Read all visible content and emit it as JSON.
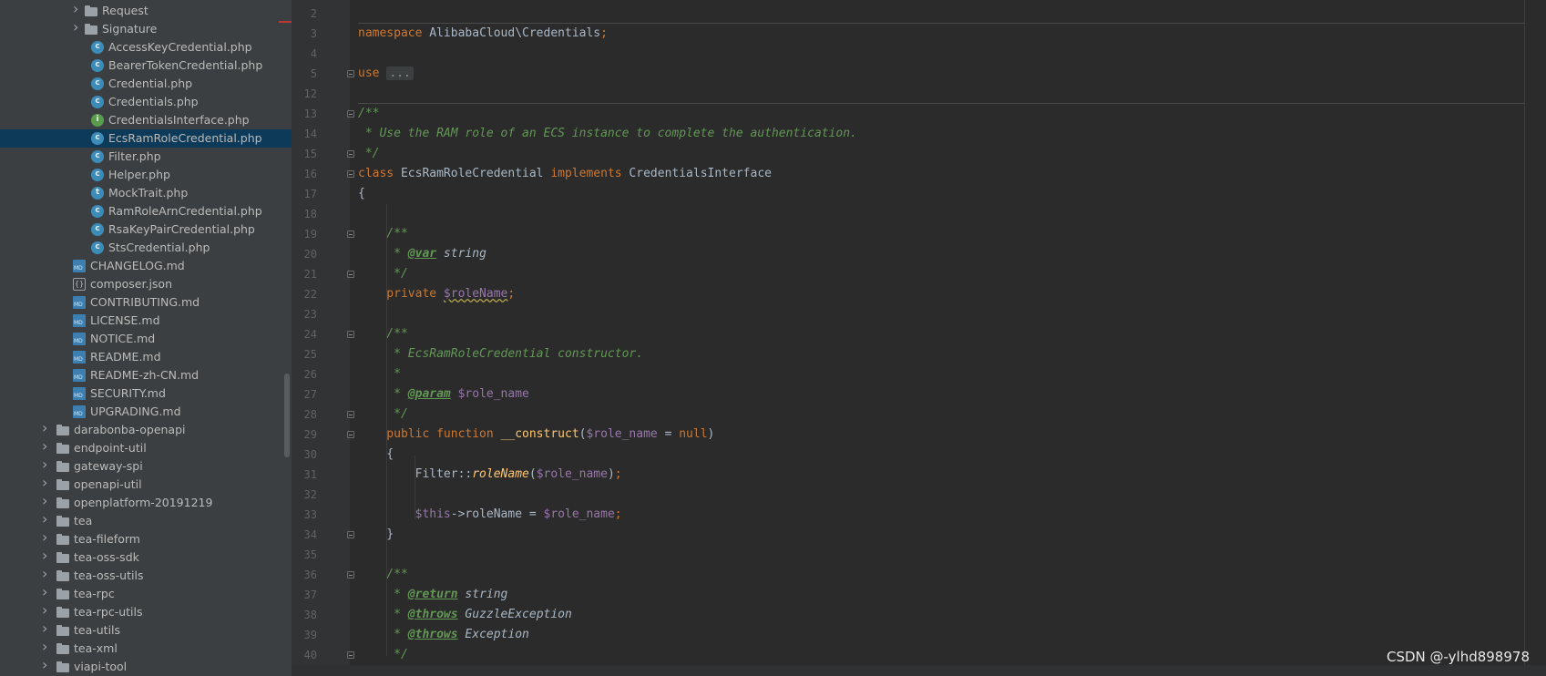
{
  "sidebar": {
    "items": [
      {
        "label": "Request",
        "type": "folder",
        "indent": 1,
        "expandable": true
      },
      {
        "label": "Signature",
        "type": "folder",
        "indent": 1,
        "expandable": true
      },
      {
        "label": "AccessKeyCredential.php",
        "type": "class",
        "indent": 2
      },
      {
        "label": "BearerTokenCredential.php",
        "type": "class",
        "indent": 2
      },
      {
        "label": "Credential.php",
        "type": "class",
        "indent": 2
      },
      {
        "label": "Credentials.php",
        "type": "class",
        "indent": 2
      },
      {
        "label": "CredentialsInterface.php",
        "type": "interface",
        "indent": 2
      },
      {
        "label": "EcsRamRoleCredential.php",
        "type": "class",
        "indent": 2,
        "selected": true
      },
      {
        "label": "Filter.php",
        "type": "class",
        "indent": 2
      },
      {
        "label": "Helper.php",
        "type": "class",
        "indent": 2
      },
      {
        "label": "MockTrait.php",
        "type": "trait",
        "indent": 2
      },
      {
        "label": "RamRoleArnCredential.php",
        "type": "class",
        "indent": 2
      },
      {
        "label": "RsaKeyPairCredential.php",
        "type": "class",
        "indent": 2
      },
      {
        "label": "StsCredential.php",
        "type": "class",
        "indent": 2
      },
      {
        "label": "CHANGELOG.md",
        "type": "md",
        "indent": 1
      },
      {
        "label": "composer.json",
        "type": "json",
        "indent": 1
      },
      {
        "label": "CONTRIBUTING.md",
        "type": "md",
        "indent": 1
      },
      {
        "label": "LICENSE.md",
        "type": "md",
        "indent": 1
      },
      {
        "label": "NOTICE.md",
        "type": "md",
        "indent": 1
      },
      {
        "label": "README.md",
        "type": "md",
        "indent": 1
      },
      {
        "label": "README-zh-CN.md",
        "type": "md",
        "indent": 1
      },
      {
        "label": "SECURITY.md",
        "type": "md",
        "indent": 1
      },
      {
        "label": "UPGRADING.md",
        "type": "md",
        "indent": 1
      },
      {
        "label": "darabonba-openapi",
        "type": "folder",
        "indent": 0,
        "expandable": true
      },
      {
        "label": "endpoint-util",
        "type": "folder",
        "indent": 0,
        "expandable": true
      },
      {
        "label": "gateway-spi",
        "type": "folder",
        "indent": 0,
        "expandable": true
      },
      {
        "label": "openapi-util",
        "type": "folder",
        "indent": 0,
        "expandable": true
      },
      {
        "label": "openplatform-20191219",
        "type": "folder",
        "indent": 0,
        "expandable": true
      },
      {
        "label": "tea",
        "type": "folder",
        "indent": 0,
        "expandable": true
      },
      {
        "label": "tea-fileform",
        "type": "folder",
        "indent": 0,
        "expandable": true
      },
      {
        "label": "tea-oss-sdk",
        "type": "folder",
        "indent": 0,
        "expandable": true
      },
      {
        "label": "tea-oss-utils",
        "type": "folder",
        "indent": 0,
        "expandable": true
      },
      {
        "label": "tea-rpc",
        "type": "folder",
        "indent": 0,
        "expandable": true
      },
      {
        "label": "tea-rpc-utils",
        "type": "folder",
        "indent": 0,
        "expandable": true
      },
      {
        "label": "tea-utils",
        "type": "folder",
        "indent": 0,
        "expandable": true
      },
      {
        "label": "tea-xml",
        "type": "folder",
        "indent": 0,
        "expandable": true
      },
      {
        "label": "viapi-tool",
        "type": "folder",
        "indent": 0,
        "expandable": true
      }
    ]
  },
  "editor": {
    "lines": [
      {
        "n": "2",
        "fold": false,
        "tokens": []
      },
      {
        "n": "3",
        "fold": false,
        "tokens": [
          {
            "t": "namespace",
            "c": "kw"
          },
          {
            "t": " AlibabaCloud\\Credentials"
          },
          {
            "t": ";",
            "c": "kw"
          }
        ]
      },
      {
        "n": "4",
        "fold": false,
        "tokens": []
      },
      {
        "n": "5",
        "fold": true,
        "tokens": [
          {
            "t": "use",
            "c": "kw"
          },
          {
            "t": " "
          },
          {
            "t": "...",
            "c": "ellipsis"
          }
        ]
      },
      {
        "n": "12",
        "fold": false,
        "tokens": []
      },
      {
        "n": "13",
        "fold": true,
        "tokens": [
          {
            "t": "/**",
            "c": "cm"
          }
        ]
      },
      {
        "n": "14",
        "fold": false,
        "tokens": [
          {
            "t": " * Use the RAM role of an ECS instance to complete the authentication.",
            "c": "cm"
          }
        ]
      },
      {
        "n": "15",
        "fold": true,
        "tokens": [
          {
            "t": " */",
            "c": "cm"
          }
        ]
      },
      {
        "n": "16",
        "fold": true,
        "tokens": [
          {
            "t": "class",
            "c": "kw"
          },
          {
            "t": " EcsRamRoleCredential "
          },
          {
            "t": "implements",
            "c": "kw"
          },
          {
            "t": " CredentialsInterface"
          }
        ]
      },
      {
        "n": "17",
        "fold": false,
        "tokens": [
          {
            "t": "{"
          }
        ]
      },
      {
        "n": "18",
        "fold": false,
        "tokens": []
      },
      {
        "n": "19",
        "fold": true,
        "tokens": [
          {
            "t": "    /**",
            "c": "cm"
          }
        ]
      },
      {
        "n": "20",
        "fold": false,
        "tokens": [
          {
            "t": "     * ",
            "c": "cm"
          },
          {
            "t": "@var",
            "c": "tag"
          },
          {
            "t": " string",
            "c": "typ"
          }
        ]
      },
      {
        "n": "21",
        "fold": true,
        "tokens": [
          {
            "t": "     */",
            "c": "cm"
          }
        ]
      },
      {
        "n": "22",
        "fold": false,
        "tokens": [
          {
            "t": "    private ",
            "c": "kw"
          },
          {
            "t": "$roleName",
            "c": "varw"
          },
          {
            "t": ";",
            "c": "kw"
          }
        ]
      },
      {
        "n": "23",
        "fold": false,
        "tokens": []
      },
      {
        "n": "24",
        "fold": true,
        "tokens": [
          {
            "t": "    /**",
            "c": "cm"
          }
        ]
      },
      {
        "n": "25",
        "fold": false,
        "tokens": [
          {
            "t": "     * EcsRamRoleCredential constructor.",
            "c": "cm"
          }
        ]
      },
      {
        "n": "26",
        "fold": false,
        "tokens": [
          {
            "t": "     *",
            "c": "cm"
          }
        ]
      },
      {
        "n": "27",
        "fold": false,
        "tokens": [
          {
            "t": "     * ",
            "c": "cm"
          },
          {
            "t": "@param",
            "c": "tag"
          },
          {
            "t": " ",
            "c": "cm"
          },
          {
            "t": "$role_name",
            "c": "var"
          }
        ]
      },
      {
        "n": "28",
        "fold": true,
        "tokens": [
          {
            "t": "     */",
            "c": "cm"
          }
        ]
      },
      {
        "n": "29",
        "fold": true,
        "tokens": [
          {
            "t": "    public ",
            "c": "kw"
          },
          {
            "t": "function ",
            "c": "kw"
          },
          {
            "t": "__construct",
            "c": "fn"
          },
          {
            "t": "("
          },
          {
            "t": "$role_name",
            "c": "var"
          },
          {
            "t": " = "
          },
          {
            "t": "null",
            "c": "kw"
          },
          {
            "t": ")"
          }
        ]
      },
      {
        "n": "30",
        "fold": false,
        "tokens": [
          {
            "t": "    {"
          }
        ]
      },
      {
        "n": "31",
        "fold": false,
        "tokens": [
          {
            "t": "        Filter::"
          },
          {
            "t": "roleName",
            "c": "fni"
          },
          {
            "t": "("
          },
          {
            "t": "$role_name",
            "c": "var"
          },
          {
            "t": ")"
          },
          {
            "t": ";",
            "c": "kw"
          }
        ]
      },
      {
        "n": "32",
        "fold": false,
        "tokens": []
      },
      {
        "n": "33",
        "fold": false,
        "tokens": [
          {
            "t": "        "
          },
          {
            "t": "$this",
            "c": "var"
          },
          {
            "t": "->roleName = "
          },
          {
            "t": "$role_name",
            "c": "var"
          },
          {
            "t": ";",
            "c": "kw"
          }
        ]
      },
      {
        "n": "34",
        "fold": true,
        "tokens": [
          {
            "t": "    }"
          }
        ]
      },
      {
        "n": "35",
        "fold": false,
        "tokens": []
      },
      {
        "n": "36",
        "fold": true,
        "tokens": [
          {
            "t": "    /**",
            "c": "cm"
          }
        ]
      },
      {
        "n": "37",
        "fold": false,
        "tokens": [
          {
            "t": "     * ",
            "c": "cm"
          },
          {
            "t": "@return",
            "c": "tag"
          },
          {
            "t": " string",
            "c": "typ"
          }
        ]
      },
      {
        "n": "38",
        "fold": false,
        "tokens": [
          {
            "t": "     * ",
            "c": "cm"
          },
          {
            "t": "@throws",
            "c": "tag"
          },
          {
            "t": " ",
            "c": "cm"
          },
          {
            "t": "GuzzleException",
            "c": "typ"
          }
        ]
      },
      {
        "n": "39",
        "fold": false,
        "tokens": [
          {
            "t": "     * ",
            "c": "cm"
          },
          {
            "t": "@throws",
            "c": "tag"
          },
          {
            "t": " Exception",
            "c": "typ"
          }
        ]
      },
      {
        "n": "40",
        "fold": true,
        "tokens": [
          {
            "t": "     */",
            "c": "cm"
          }
        ]
      }
    ]
  },
  "watermark": "CSDN @-ylhd898978",
  "colors": {
    "sidebar_bg": "#3c3f41",
    "editor_bg": "#2b2b2b",
    "selection": "#0d3a58",
    "keyword": "#cc7832",
    "comment": "#629755",
    "variable": "#9876aa",
    "function": "#ffc66d"
  }
}
